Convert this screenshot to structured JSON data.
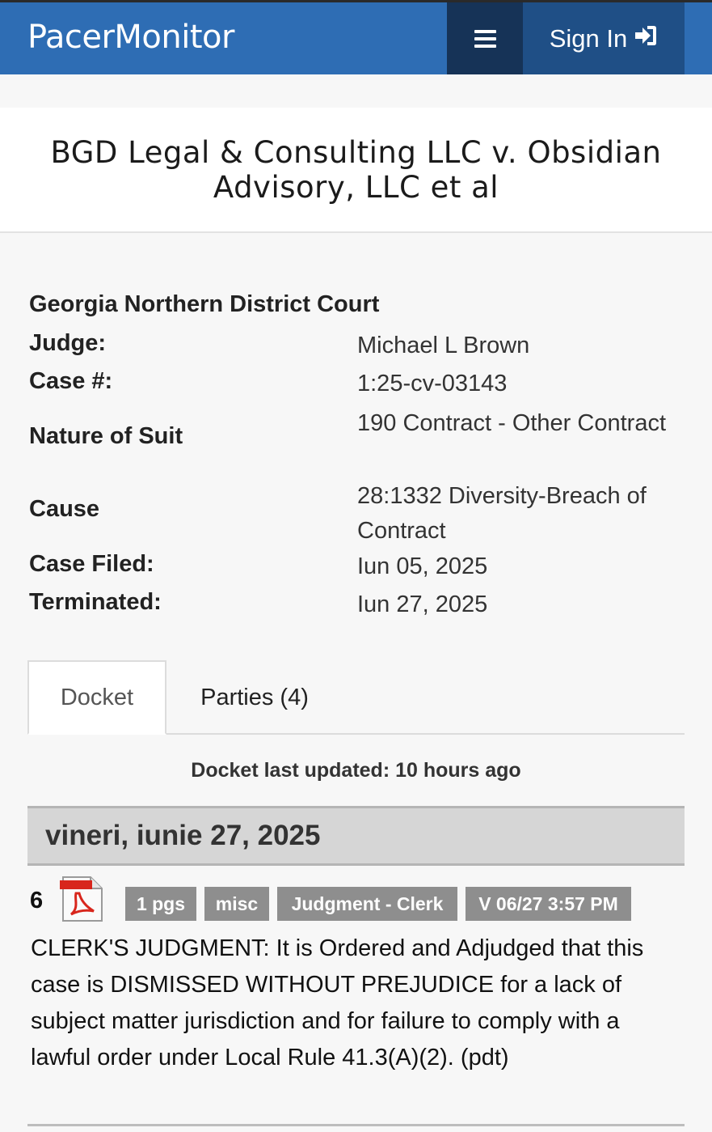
{
  "header": {
    "brand": "PacerMonitor",
    "menu_icon": "hamburger-menu-icon",
    "signin_label": "Sign In",
    "signin_icon": "sign-in-icon",
    "colors": {
      "bar": "#2e6db4",
      "menu_bg": "#163357",
      "signin_bg": "#1f4f86"
    }
  },
  "case": {
    "title": "BGD Legal & Consulting LLC v. Obsidian Advisory, LLC et al",
    "court": "Georgia Northern District Court",
    "fields": [
      {
        "label": "Judge:",
        "value": "Michael L Brown"
      },
      {
        "label": "Case #:",
        "value": "1:25-cv-03143"
      },
      {
        "label": "Nature of Suit",
        "value": "190 Contract - Other Contract"
      },
      {
        "label": "Cause",
        "value": "28:1332 Diversity-Breach of Contract"
      },
      {
        "label": "Case Filed:",
        "value": "Iun 05, 2025"
      },
      {
        "label": "Terminated:",
        "value": "Iun 27, 2025"
      }
    ]
  },
  "tabs": [
    {
      "label": "Docket",
      "active": true
    },
    {
      "label": "Parties (4)",
      "active": false
    }
  ],
  "docket": {
    "updated": "Docket last updated: 10 hours ago",
    "date_heading": "vineri, iunie 27, 2025",
    "entries": [
      {
        "number": "6",
        "icon": "pdf-icon",
        "badges": [
          "1 pgs",
          "misc",
          "Judgment - Clerk",
          "V 06/27 3:57 PM"
        ],
        "text": "CLERK'S JUDGMENT: It is Ordered and Adjudged that this case is DISMISSED WITHOUT PREJUDICE for a lack of subject matter jurisdiction and for failure to comply with a lawful order under Local Rule 41.3(A)(2). (pdt)"
      }
    ]
  }
}
